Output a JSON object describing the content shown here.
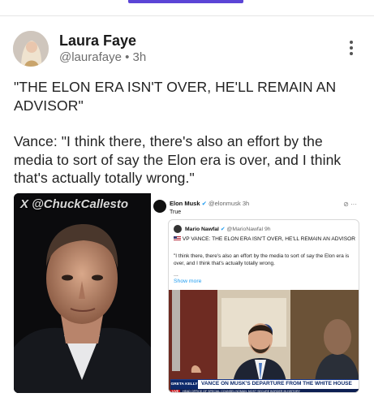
{
  "post": {
    "author": {
      "name": "Laura Faye",
      "handle": "@laurafaye",
      "separator": "•",
      "time": "3h"
    },
    "paragraphs": [
      "\"THE ELON ERA ISN'T OVER, HE'LL REMAIN AN ADVISOR\"",
      "Vance: \"I think there, there's also an effort by the media to sort of say the Elon era is over, and I think that's actually totally wrong.\""
    ]
  },
  "media": {
    "left": {
      "watermark": "X @ChuckCallesto",
      "icon": "elon-portrait"
    },
    "right": {
      "tweet": {
        "name": "Elon Musk",
        "handle": "@elonmusk",
        "time": "3h",
        "body": "True"
      },
      "quote": {
        "name": "Mario Nawfal",
        "handle": "@MarioNawfal",
        "time": "9h",
        "line1": "VP VANCE: THE ELON ERA ISN'T OVER, HE'LL REMAIN AN ADVISOR",
        "body": "\"I think there, there's also an effort by the media to sort of say the Elon era is over, and I think that's actually totally wrong.",
        "ellipsis": "...",
        "show_more": "Show more"
      },
      "video": {
        "logo": "GRETA KELLY",
        "chyron": "VANCE ON MUSK'S DEPARTURE FROM THE WHITE HOUSE",
        "live": "LIVE",
        "ticker": "HEAD OFFICE OF SPECIAL COUNSEL   NOMAN: MOST SECURE BORDER IN HISTORY"
      }
    }
  },
  "colors": {
    "accent": "#5b45d6",
    "link": "#1d9bf0",
    "chyron_navy": "#0d2a6b",
    "live_red": "#c3141b"
  }
}
